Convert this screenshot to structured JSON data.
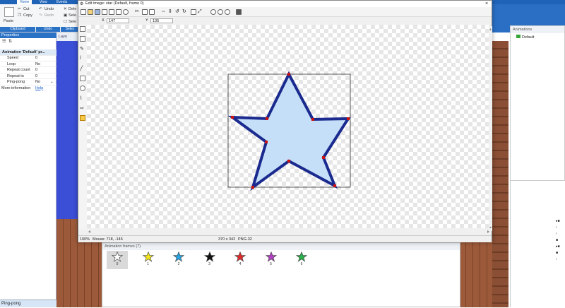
{
  "ribbon": {
    "tabs": [
      "Home",
      "View",
      "Events"
    ],
    "paste_label": "Paste",
    "cut_label": "Cut",
    "copy_label": "Copy",
    "undo_label": "Undo",
    "redo_label": "Redo",
    "delete_label": "Dele",
    "select_label": "Sele",
    "select2_label": "Sele",
    "groups": [
      "Clipboard",
      "Undo",
      "Selec"
    ]
  },
  "properties": {
    "title": "Properties",
    "section": "Animation 'Default' pr...",
    "rows": [
      {
        "key": "Speed",
        "value": "0"
      },
      {
        "key": "Loop",
        "value": "No"
      },
      {
        "key": "Repeat count",
        "value": "0"
      },
      {
        "key": "Repeat to",
        "value": "0"
      },
      {
        "key": "Ping-pong",
        "value": "No"
      },
      {
        "key": "More information",
        "value": "Help"
      }
    ],
    "status": "Ping-pong"
  },
  "layout_tab": "Layo",
  "editor": {
    "title": "Edit image: star (Default, frame 0)",
    "x_label": "X",
    "x_value": "147",
    "y_label": "Y",
    "y_value": "135",
    "status_zoom": "100%",
    "status_mouse": "Mouse: 718, -146",
    "status_size": "370 x 342",
    "status_format": "PNG-32",
    "star_fill": "#c4dff7",
    "star_stroke": "#1a2a8f",
    "point_color": "#cc1111"
  },
  "frames_panel": {
    "title": "Animation frames (7)",
    "frames": [
      {
        "label": "0",
        "color": "#ffffff"
      },
      {
        "label": "1",
        "color": "#f4e61a"
      },
      {
        "label": "2",
        "color": "#2aa4e0"
      },
      {
        "label": "3",
        "color": "#111111"
      },
      {
        "label": "4",
        "color": "#e02a2a"
      },
      {
        "label": "5",
        "color": "#b040c0"
      },
      {
        "label": "6",
        "color": "#2ab04a"
      }
    ]
  },
  "animations_panel": {
    "title": "Animations",
    "item": "Default"
  }
}
